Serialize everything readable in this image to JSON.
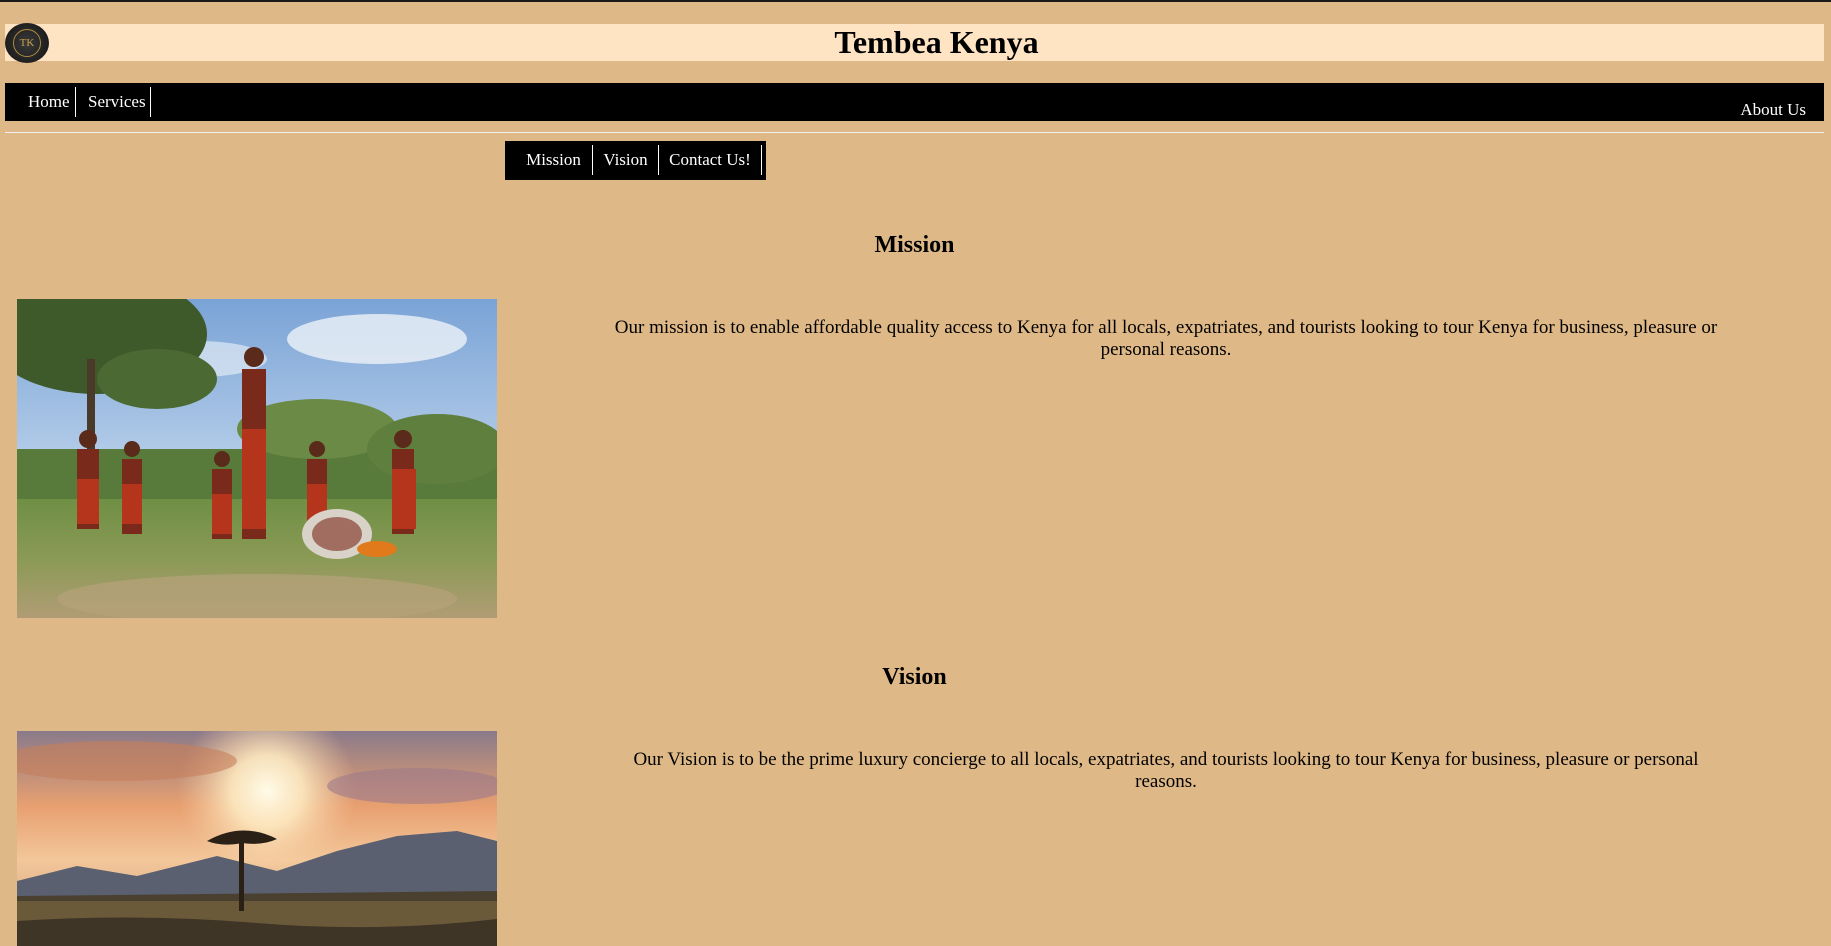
{
  "header": {
    "title": "Tembea Kenya",
    "logo_text": "TK"
  },
  "main_nav": {
    "items": [
      {
        "label": "Home"
      },
      {
        "label": "Services"
      }
    ],
    "right_label": "About Us"
  },
  "sub_nav": {
    "items": [
      {
        "label": "Mission"
      },
      {
        "label": "Vision"
      },
      {
        "label": "Contact Us!"
      }
    ]
  },
  "sections": {
    "mission": {
      "heading": "Mission",
      "text": "Our mission is to enable affordable quality access to Kenya for all locals, expatriates, and tourists looking to tour Kenya for business, pleasure or personal reasons."
    },
    "vision": {
      "heading": "Vision",
      "text": "Our Vision is to be the prime luxury concierge to all locals, expatriates, and tourists looking to tour Kenya for business, pleasure or personal reasons."
    }
  },
  "colors": {
    "page_background": "#deb887",
    "header_background": "#ffe4c4",
    "nav_background": "#000000",
    "nav_text": "#ffffff"
  }
}
